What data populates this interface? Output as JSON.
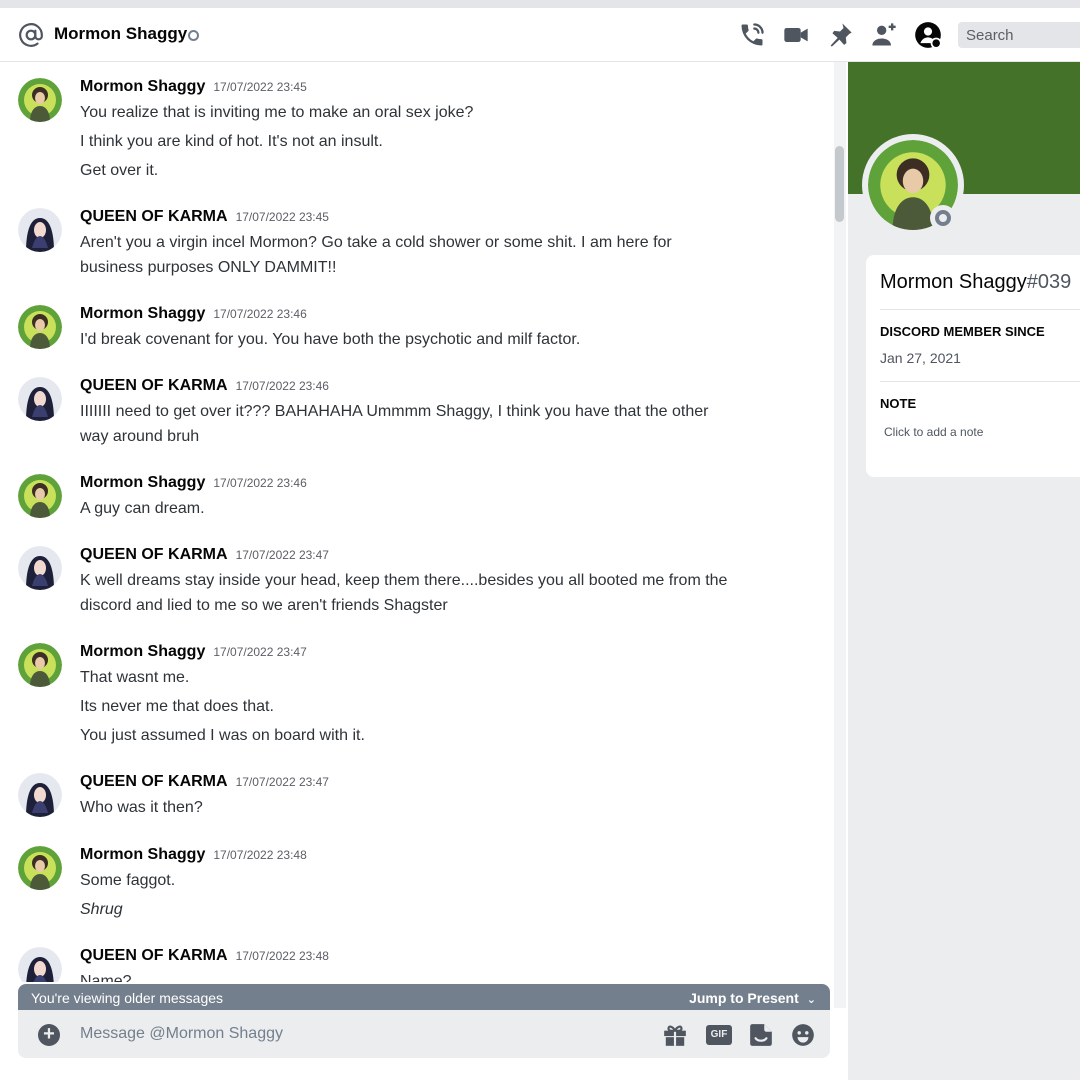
{
  "header": {
    "title": "Mormon Shaggy",
    "search_placeholder": "Search",
    "icons": [
      "at-icon",
      "phone-call-icon",
      "video-camera-icon",
      "pin-icon",
      "add-friend-icon",
      "user-profile-icon"
    ]
  },
  "messages": [
    {
      "author": "Mormon Shaggy",
      "timestamp": "17/07/2022 23:45",
      "lines": [
        "You realize that is inviting me to make an oral sex joke?",
        "I think you are kind of hot. It's not an insult.",
        "Get over it."
      ]
    },
    {
      "author": "QUEEN OF KARMA",
      "timestamp": "17/07/2022 23:45",
      "lines": [
        "Aren't you a virgin incel Mormon? Go take a cold shower or some shit. I am here for",
        "business purposes ONLY DAMMIT!!"
      ]
    },
    {
      "author": "Mormon Shaggy",
      "timestamp": "17/07/2022 23:46",
      "lines": [
        "I'd break covenant for you. You have both the psychotic and milf factor."
      ]
    },
    {
      "author": "QUEEN OF KARMA",
      "timestamp": "17/07/2022 23:46",
      "lines": [
        "IIIIIII need to get over it??? BAHAHAHA Ummmm Shaggy, I think you have that the other",
        "way around bruh"
      ]
    },
    {
      "author": "Mormon Shaggy",
      "timestamp": "17/07/2022 23:46",
      "lines": [
        "A guy can dream."
      ]
    },
    {
      "author": "QUEEN OF KARMA",
      "timestamp": "17/07/2022 23:47",
      "lines": [
        "K well dreams stay inside your head, keep them there....besides you all booted me from the",
        "discord and lied to me so we aren't friends Shagster"
      ]
    },
    {
      "author": "Mormon Shaggy",
      "timestamp": "17/07/2022 23:47",
      "lines": [
        "That wasnt me.",
        "Its never me that does that.",
        "You just assumed I was on board with it."
      ]
    },
    {
      "author": "QUEEN OF KARMA",
      "timestamp": "17/07/2022 23:47",
      "lines": [
        "Who was it then?"
      ]
    },
    {
      "author": "Mormon Shaggy",
      "timestamp": "17/07/2022 23:48",
      "lines": [
        "Some faggot.",
        "Shrug"
      ]
    },
    {
      "author": "QUEEN OF KARMA",
      "timestamp": "17/07/2022 23:48",
      "lines": [
        "Name?"
      ]
    }
  ],
  "older_bar": {
    "text": "You're viewing older messages",
    "jump_label": "Jump to Present"
  },
  "composer": {
    "placeholder": "Message @Mormon Shaggy",
    "gif_label": "GIF"
  },
  "profile": {
    "username": "Mormon Shaggy",
    "discriminator": "#039",
    "member_since_label": "DISCORD MEMBER SINCE",
    "member_since": "Jan 27, 2021",
    "note_label": "NOTE",
    "note_placeholder": "Click to add a note",
    "banner_color": "#447228"
  },
  "colors": {
    "status_offline": "#747f8d",
    "older_bar": "#747f8d"
  }
}
